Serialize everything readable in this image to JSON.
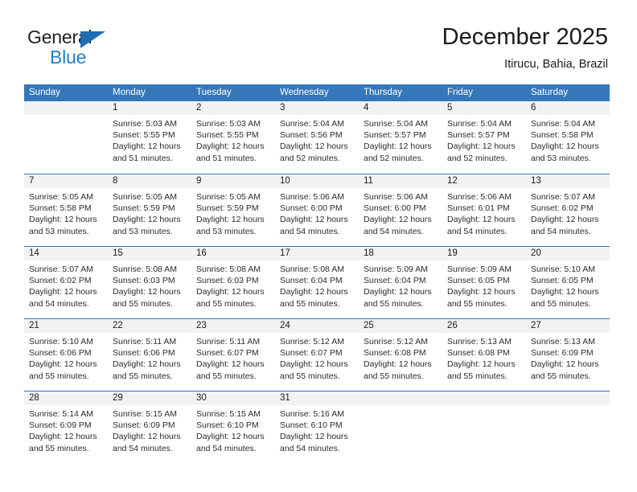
{
  "brand": {
    "name_top": "General",
    "name_bottom": "Blue",
    "triangle_color": "#1f6db5",
    "blue_color": "#2083c8"
  },
  "header": {
    "title": "December 2025",
    "subtitle": "Itirucu, Bahia, Brazil"
  },
  "theme": {
    "header_blue": "#3577b8",
    "day_number_band": "#f2f2f2",
    "text": "#2b2b2b"
  },
  "weekdays": [
    "Sunday",
    "Monday",
    "Tuesday",
    "Wednesday",
    "Thursday",
    "Friday",
    "Saturday"
  ],
  "weeks": [
    [
      {
        "day": "",
        "lines": []
      },
      {
        "day": "1",
        "lines": [
          "Sunrise: 5:03 AM",
          "Sunset: 5:55 PM",
          "Daylight: 12 hours",
          "and 51 minutes."
        ]
      },
      {
        "day": "2",
        "lines": [
          "Sunrise: 5:03 AM",
          "Sunset: 5:55 PM",
          "Daylight: 12 hours",
          "and 51 minutes."
        ]
      },
      {
        "day": "3",
        "lines": [
          "Sunrise: 5:04 AM",
          "Sunset: 5:56 PM",
          "Daylight: 12 hours",
          "and 52 minutes."
        ]
      },
      {
        "day": "4",
        "lines": [
          "Sunrise: 5:04 AM",
          "Sunset: 5:57 PM",
          "Daylight: 12 hours",
          "and 52 minutes."
        ]
      },
      {
        "day": "5",
        "lines": [
          "Sunrise: 5:04 AM",
          "Sunset: 5:57 PM",
          "Daylight: 12 hours",
          "and 52 minutes."
        ]
      },
      {
        "day": "6",
        "lines": [
          "Sunrise: 5:04 AM",
          "Sunset: 5:58 PM",
          "Daylight: 12 hours",
          "and 53 minutes."
        ]
      }
    ],
    [
      {
        "day": "7",
        "lines": [
          "Sunrise: 5:05 AM",
          "Sunset: 5:58 PM",
          "Daylight: 12 hours",
          "and 53 minutes."
        ]
      },
      {
        "day": "8",
        "lines": [
          "Sunrise: 5:05 AM",
          "Sunset: 5:59 PM",
          "Daylight: 12 hours",
          "and 53 minutes."
        ]
      },
      {
        "day": "9",
        "lines": [
          "Sunrise: 5:05 AM",
          "Sunset: 5:59 PM",
          "Daylight: 12 hours",
          "and 53 minutes."
        ]
      },
      {
        "day": "10",
        "lines": [
          "Sunrise: 5:06 AM",
          "Sunset: 6:00 PM",
          "Daylight: 12 hours",
          "and 54 minutes."
        ]
      },
      {
        "day": "11",
        "lines": [
          "Sunrise: 5:06 AM",
          "Sunset: 6:00 PM",
          "Daylight: 12 hours",
          "and 54 minutes."
        ]
      },
      {
        "day": "12",
        "lines": [
          "Sunrise: 5:06 AM",
          "Sunset: 6:01 PM",
          "Daylight: 12 hours",
          "and 54 minutes."
        ]
      },
      {
        "day": "13",
        "lines": [
          "Sunrise: 5:07 AM",
          "Sunset: 6:02 PM",
          "Daylight: 12 hours",
          "and 54 minutes."
        ]
      }
    ],
    [
      {
        "day": "14",
        "lines": [
          "Sunrise: 5:07 AM",
          "Sunset: 6:02 PM",
          "Daylight: 12 hours",
          "and 54 minutes."
        ]
      },
      {
        "day": "15",
        "lines": [
          "Sunrise: 5:08 AM",
          "Sunset: 6:03 PM",
          "Daylight: 12 hours",
          "and 55 minutes."
        ]
      },
      {
        "day": "16",
        "lines": [
          "Sunrise: 5:08 AM",
          "Sunset: 6:03 PM",
          "Daylight: 12 hours",
          "and 55 minutes."
        ]
      },
      {
        "day": "17",
        "lines": [
          "Sunrise: 5:08 AM",
          "Sunset: 6:04 PM",
          "Daylight: 12 hours",
          "and 55 minutes."
        ]
      },
      {
        "day": "18",
        "lines": [
          "Sunrise: 5:09 AM",
          "Sunset: 6:04 PM",
          "Daylight: 12 hours",
          "and 55 minutes."
        ]
      },
      {
        "day": "19",
        "lines": [
          "Sunrise: 5:09 AM",
          "Sunset: 6:05 PM",
          "Daylight: 12 hours",
          "and 55 minutes."
        ]
      },
      {
        "day": "20",
        "lines": [
          "Sunrise: 5:10 AM",
          "Sunset: 6:05 PM",
          "Daylight: 12 hours",
          "and 55 minutes."
        ]
      }
    ],
    [
      {
        "day": "21",
        "lines": [
          "Sunrise: 5:10 AM",
          "Sunset: 6:06 PM",
          "Daylight: 12 hours",
          "and 55 minutes."
        ]
      },
      {
        "day": "22",
        "lines": [
          "Sunrise: 5:11 AM",
          "Sunset: 6:06 PM",
          "Daylight: 12 hours",
          "and 55 minutes."
        ]
      },
      {
        "day": "23",
        "lines": [
          "Sunrise: 5:11 AM",
          "Sunset: 6:07 PM",
          "Daylight: 12 hours",
          "and 55 minutes."
        ]
      },
      {
        "day": "24",
        "lines": [
          "Sunrise: 5:12 AM",
          "Sunset: 6:07 PM",
          "Daylight: 12 hours",
          "and 55 minutes."
        ]
      },
      {
        "day": "25",
        "lines": [
          "Sunrise: 5:12 AM",
          "Sunset: 6:08 PM",
          "Daylight: 12 hours",
          "and 55 minutes."
        ]
      },
      {
        "day": "26",
        "lines": [
          "Sunrise: 5:13 AM",
          "Sunset: 6:08 PM",
          "Daylight: 12 hours",
          "and 55 minutes."
        ]
      },
      {
        "day": "27",
        "lines": [
          "Sunrise: 5:13 AM",
          "Sunset: 6:09 PM",
          "Daylight: 12 hours",
          "and 55 minutes."
        ]
      }
    ],
    [
      {
        "day": "28",
        "lines": [
          "Sunrise: 5:14 AM",
          "Sunset: 6:09 PM",
          "Daylight: 12 hours",
          "and 55 minutes."
        ]
      },
      {
        "day": "29",
        "lines": [
          "Sunrise: 5:15 AM",
          "Sunset: 6:09 PM",
          "Daylight: 12 hours",
          "and 54 minutes."
        ]
      },
      {
        "day": "30",
        "lines": [
          "Sunrise: 5:15 AM",
          "Sunset: 6:10 PM",
          "Daylight: 12 hours",
          "and 54 minutes."
        ]
      },
      {
        "day": "31",
        "lines": [
          "Sunrise: 5:16 AM",
          "Sunset: 6:10 PM",
          "Daylight: 12 hours",
          "and 54 minutes."
        ]
      },
      {
        "day": "",
        "lines": []
      },
      {
        "day": "",
        "lines": []
      },
      {
        "day": "",
        "lines": []
      }
    ]
  ]
}
